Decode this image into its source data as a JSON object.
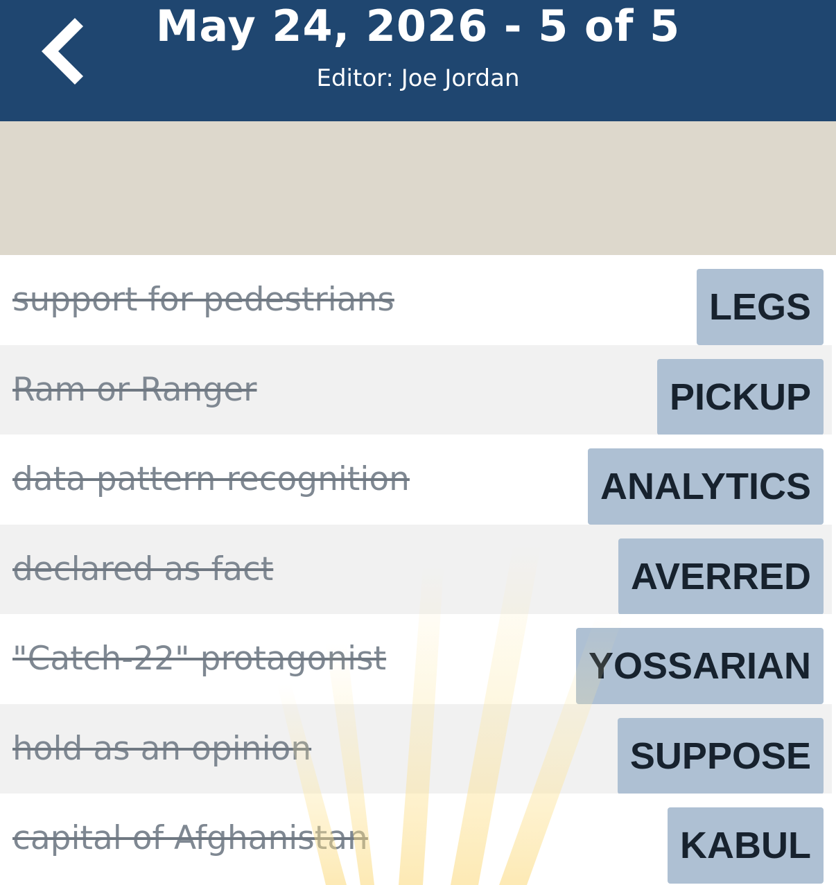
{
  "header": {
    "title": "May 24, 2026 - 5 of 5",
    "subtitle": "Editor: Joe Jordan",
    "back_icon": "chevron-left-icon"
  },
  "colors": {
    "header_bg": "#1f4670",
    "banner_bg": "#ddd8cc",
    "answer_bg": "#aec0d3",
    "clue_text": "#7f8892"
  },
  "rows": [
    {
      "clue": "support for pedestrians",
      "answer": "LEGS"
    },
    {
      "clue": "Ram or Ranger",
      "answer": "PICKUP"
    },
    {
      "clue": "data pattern recognition",
      "answer": "ANALYTICS"
    },
    {
      "clue": "declared as fact",
      "answer": "AVERRED"
    },
    {
      "clue": "\"Catch-22\" protagonist",
      "answer": "YOSSARIAN"
    },
    {
      "clue": "hold as an opinion",
      "answer": "SUPPOSE"
    },
    {
      "clue": "capital of Afghanistan",
      "answer": "KABUL"
    }
  ]
}
